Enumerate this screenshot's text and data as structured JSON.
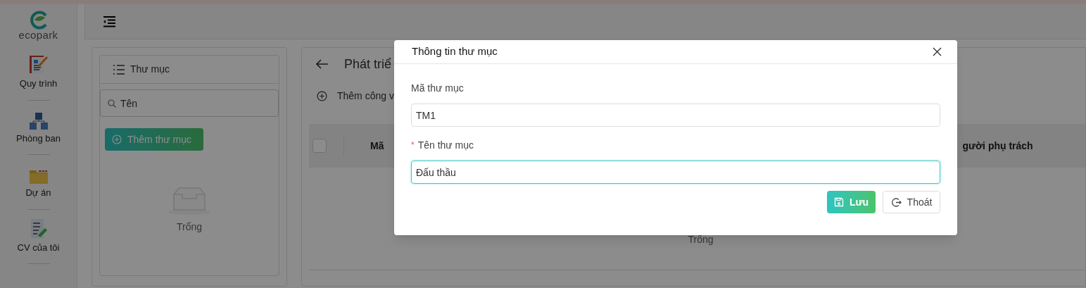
{
  "sidebar": {
    "logo_text": "ecopark",
    "items": [
      {
        "label": "Quy trình"
      },
      {
        "label": "Phòng ban"
      },
      {
        "label": "Dự án"
      },
      {
        "label": "CV của tôi"
      }
    ]
  },
  "folder_panel": {
    "title": "Thư mục",
    "search": {
      "placeholder": "Tên"
    },
    "add_button": "Thêm thư mục",
    "empty_text": "Trống"
  },
  "main_panel": {
    "title": "Phát triể",
    "add_button": "Thêm công v",
    "table": {
      "select_all_checked": false,
      "columns": [
        "Mã",
        "gười phụ trách"
      ]
    },
    "empty_text": "Trống"
  },
  "dialog": {
    "title": "Thông tin thư mục",
    "fields": [
      {
        "label": "Mã thư mục",
        "value": "TM1",
        "focused": false
      },
      {
        "label": "Tên thư mục",
        "required_mark": "*",
        "value": "Đấu thầu",
        "focused": true
      }
    ],
    "buttons": [
      {
        "label": "Lưu",
        "kind": "primary"
      },
      {
        "label": "Thoát",
        "kind": "secondary"
      }
    ]
  }
}
